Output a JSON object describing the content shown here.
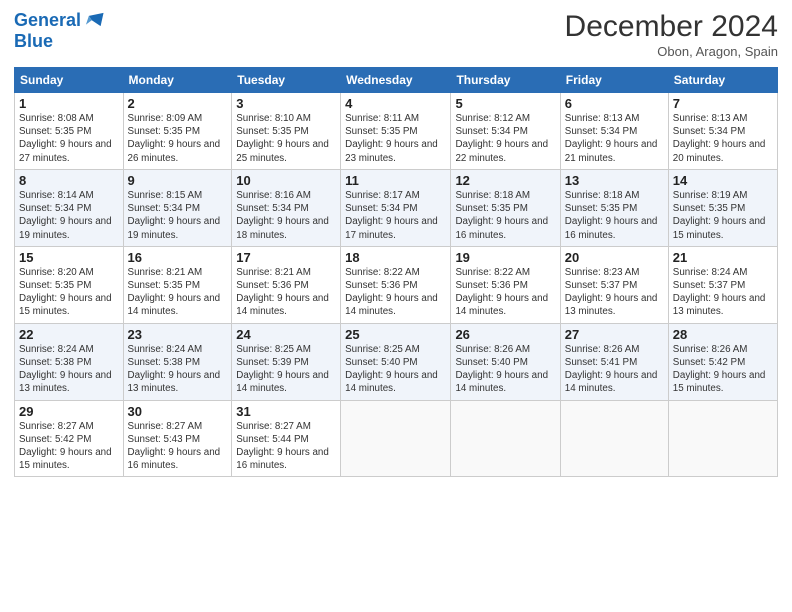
{
  "header": {
    "logo_line1": "General",
    "logo_line2": "Blue",
    "month": "December 2024",
    "location": "Obon, Aragon, Spain"
  },
  "weekdays": [
    "Sunday",
    "Monday",
    "Tuesday",
    "Wednesday",
    "Thursday",
    "Friday",
    "Saturday"
  ],
  "weeks": [
    [
      {
        "day": "1",
        "sunrise": "8:08 AM",
        "sunset": "5:35 PM",
        "daylight": "9 hours and 27 minutes."
      },
      {
        "day": "2",
        "sunrise": "8:09 AM",
        "sunset": "5:35 PM",
        "daylight": "9 hours and 26 minutes."
      },
      {
        "day": "3",
        "sunrise": "8:10 AM",
        "sunset": "5:35 PM",
        "daylight": "9 hours and 25 minutes."
      },
      {
        "day": "4",
        "sunrise": "8:11 AM",
        "sunset": "5:35 PM",
        "daylight": "9 hours and 23 minutes."
      },
      {
        "day": "5",
        "sunrise": "8:12 AM",
        "sunset": "5:34 PM",
        "daylight": "9 hours and 22 minutes."
      },
      {
        "day": "6",
        "sunrise": "8:13 AM",
        "sunset": "5:34 PM",
        "daylight": "9 hours and 21 minutes."
      },
      {
        "day": "7",
        "sunrise": "8:13 AM",
        "sunset": "5:34 PM",
        "daylight": "9 hours and 20 minutes."
      }
    ],
    [
      {
        "day": "8",
        "sunrise": "8:14 AM",
        "sunset": "5:34 PM",
        "daylight": "9 hours and 19 minutes."
      },
      {
        "day": "9",
        "sunrise": "8:15 AM",
        "sunset": "5:34 PM",
        "daylight": "9 hours and 19 minutes."
      },
      {
        "day": "10",
        "sunrise": "8:16 AM",
        "sunset": "5:34 PM",
        "daylight": "9 hours and 18 minutes."
      },
      {
        "day": "11",
        "sunrise": "8:17 AM",
        "sunset": "5:34 PM",
        "daylight": "9 hours and 17 minutes."
      },
      {
        "day": "12",
        "sunrise": "8:18 AM",
        "sunset": "5:35 PM",
        "daylight": "9 hours and 16 minutes."
      },
      {
        "day": "13",
        "sunrise": "8:18 AM",
        "sunset": "5:35 PM",
        "daylight": "9 hours and 16 minutes."
      },
      {
        "day": "14",
        "sunrise": "8:19 AM",
        "sunset": "5:35 PM",
        "daylight": "9 hours and 15 minutes."
      }
    ],
    [
      {
        "day": "15",
        "sunrise": "8:20 AM",
        "sunset": "5:35 PM",
        "daylight": "9 hours and 15 minutes."
      },
      {
        "day": "16",
        "sunrise": "8:21 AM",
        "sunset": "5:35 PM",
        "daylight": "9 hours and 14 minutes."
      },
      {
        "day": "17",
        "sunrise": "8:21 AM",
        "sunset": "5:36 PM",
        "daylight": "9 hours and 14 minutes."
      },
      {
        "day": "18",
        "sunrise": "8:22 AM",
        "sunset": "5:36 PM",
        "daylight": "9 hours and 14 minutes."
      },
      {
        "day": "19",
        "sunrise": "8:22 AM",
        "sunset": "5:36 PM",
        "daylight": "9 hours and 14 minutes."
      },
      {
        "day": "20",
        "sunrise": "8:23 AM",
        "sunset": "5:37 PM",
        "daylight": "9 hours and 13 minutes."
      },
      {
        "day": "21",
        "sunrise": "8:24 AM",
        "sunset": "5:37 PM",
        "daylight": "9 hours and 13 minutes."
      }
    ],
    [
      {
        "day": "22",
        "sunrise": "8:24 AM",
        "sunset": "5:38 PM",
        "daylight": "9 hours and 13 minutes."
      },
      {
        "day": "23",
        "sunrise": "8:24 AM",
        "sunset": "5:38 PM",
        "daylight": "9 hours and 13 minutes."
      },
      {
        "day": "24",
        "sunrise": "8:25 AM",
        "sunset": "5:39 PM",
        "daylight": "9 hours and 14 minutes."
      },
      {
        "day": "25",
        "sunrise": "8:25 AM",
        "sunset": "5:40 PM",
        "daylight": "9 hours and 14 minutes."
      },
      {
        "day": "26",
        "sunrise": "8:26 AM",
        "sunset": "5:40 PM",
        "daylight": "9 hours and 14 minutes."
      },
      {
        "day": "27",
        "sunrise": "8:26 AM",
        "sunset": "5:41 PM",
        "daylight": "9 hours and 14 minutes."
      },
      {
        "day": "28",
        "sunrise": "8:26 AM",
        "sunset": "5:42 PM",
        "daylight": "9 hours and 15 minutes."
      }
    ],
    [
      {
        "day": "29",
        "sunrise": "8:27 AM",
        "sunset": "5:42 PM",
        "daylight": "9 hours and 15 minutes."
      },
      {
        "day": "30",
        "sunrise": "8:27 AM",
        "sunset": "5:43 PM",
        "daylight": "9 hours and 16 minutes."
      },
      {
        "day": "31",
        "sunrise": "8:27 AM",
        "sunset": "5:44 PM",
        "daylight": "9 hours and 16 minutes."
      },
      null,
      null,
      null,
      null
    ]
  ]
}
